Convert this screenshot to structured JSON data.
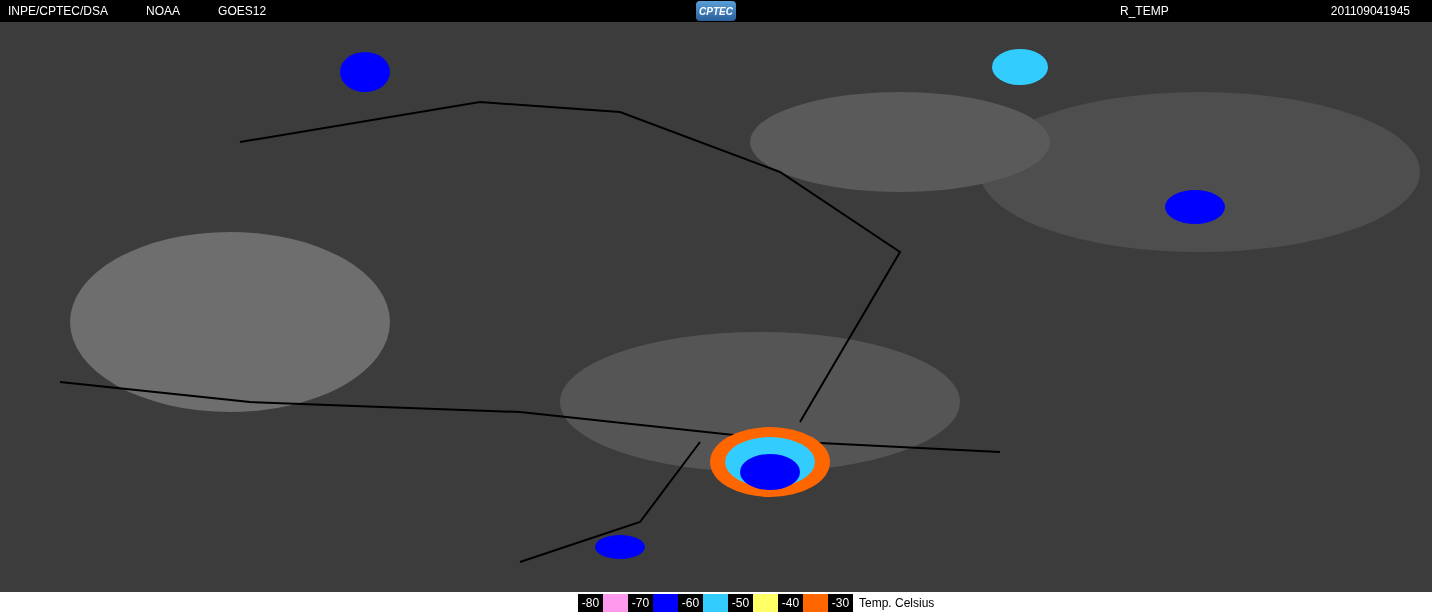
{
  "header": {
    "left_labels": [
      "INPE/CPTEC/DSA",
      "NOAA",
      "GOES12"
    ],
    "logo": "CPTEC",
    "product": "R_TEMP",
    "timestamp": "201109041945"
  },
  "legend": {
    "items": [
      {
        "label": "-80",
        "color": "#ff99ee"
      },
      {
        "label": "-70",
        "color": "#0000ff"
      },
      {
        "label": "-60",
        "color": "#33ccff"
      },
      {
        "label": "-50",
        "color": "#ffff66"
      },
      {
        "label": "-40",
        "color": "#ff6600"
      },
      {
        "label": "-30"
      }
    ],
    "caption": "Temp. Celsius"
  }
}
